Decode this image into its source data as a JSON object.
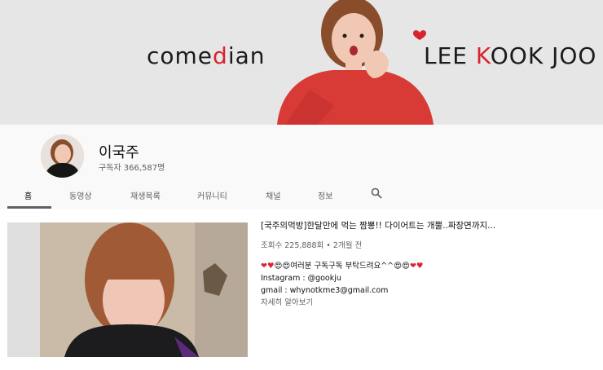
{
  "banner": {
    "left_parts": [
      "come",
      "d",
      "ian"
    ],
    "right_parts": [
      "LEE ",
      "K",
      "OOK JOO"
    ]
  },
  "channel": {
    "name": "이국주",
    "subscribers": "구독자 366,587명"
  },
  "tabs": [
    {
      "label": "홈",
      "active": true
    },
    {
      "label": "동영상"
    },
    {
      "label": "재생목록"
    },
    {
      "label": "커뮤니티"
    },
    {
      "label": "채널"
    },
    {
      "label": "정보"
    }
  ],
  "featured": {
    "title": "[국주의먹방]한달만에 먹는 짬뽕!! 다이어트는 개뿔..짜장면까지...",
    "meta": "조회수 225,888회 • 2개월 전",
    "desc_line1": "여러분 구독구독 부탁드려요^^",
    "desc_line2": "Instagram : @gookju",
    "desc_line3": "gmail : whynotkme3@gmail.com",
    "more": "자세히 알아보기"
  },
  "colors": {
    "banner_bg": "#e6e6e6",
    "accent_red": "#d8242f",
    "header_bg": "#f9f9f9",
    "text_secondary": "#606060"
  },
  "icons": [
    "search-icon"
  ]
}
